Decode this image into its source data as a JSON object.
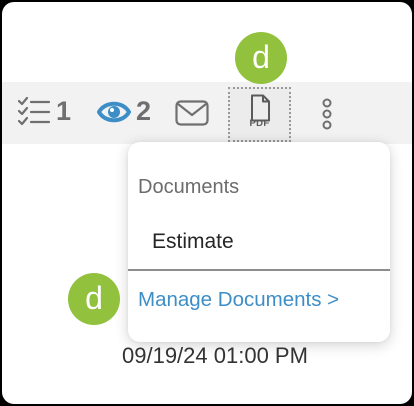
{
  "toolbar": {
    "checklist_count": "1",
    "watchers_count": "2",
    "pdf_label": "PDF"
  },
  "markers": {
    "top_letter": "d",
    "menu_letter": "d"
  },
  "documents_menu": {
    "header": "Documents",
    "items": [
      {
        "label": "Estimate"
      }
    ],
    "manage_link": "Manage Documents >"
  },
  "timestamp": "09/19/24 01:00 PM",
  "colors": {
    "marker": "#92c13e",
    "watchers_icon": "#3d8ec7",
    "link": "#3d8ec7"
  }
}
